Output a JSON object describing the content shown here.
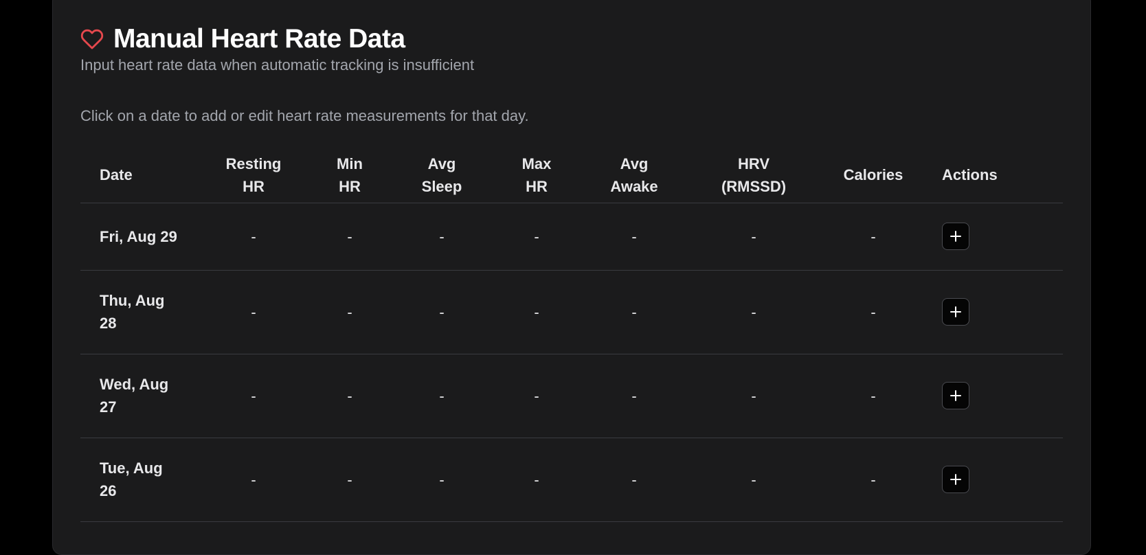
{
  "card": {
    "title": "Manual Heart Rate Data",
    "subtitle": "Input heart rate data when automatic tracking is insufficient",
    "instructions": "Click on a date to add or edit heart rate measurements for that day.",
    "icon": "heart-icon",
    "accent_color": "#e5484d"
  },
  "table": {
    "headers": {
      "date": "Date",
      "resting_hr": [
        "Resting",
        "HR"
      ],
      "min_hr": [
        "Min",
        "HR"
      ],
      "avg_sleep": [
        "Avg",
        "Sleep"
      ],
      "max_hr": [
        "Max",
        "HR"
      ],
      "avg_awake": [
        "Avg",
        "Awake"
      ],
      "hrv": [
        "HRV",
        "(RMSSD)"
      ],
      "calories": "Calories",
      "actions": "Actions"
    },
    "rows": [
      {
        "date": "Fri, Aug 29",
        "resting_hr": "-",
        "min_hr": "-",
        "avg_sleep": "-",
        "max_hr": "-",
        "avg_awake": "-",
        "hrv": "-",
        "calories": "-",
        "action_icon": "plus-icon"
      },
      {
        "date": [
          "Thu, Aug",
          "28"
        ],
        "resting_hr": "-",
        "min_hr": "-",
        "avg_sleep": "-",
        "max_hr": "-",
        "avg_awake": "-",
        "hrv": "-",
        "calories": "-",
        "action_icon": "plus-icon"
      },
      {
        "date": [
          "Wed, Aug",
          "27"
        ],
        "resting_hr": "-",
        "min_hr": "-",
        "avg_sleep": "-",
        "max_hr": "-",
        "avg_awake": "-",
        "hrv": "-",
        "calories": "-",
        "action_icon": "plus-icon"
      },
      {
        "date": [
          "Tue, Aug",
          "26"
        ],
        "resting_hr": "-",
        "min_hr": "-",
        "avg_sleep": "-",
        "max_hr": "-",
        "avg_awake": "-",
        "hrv": "-",
        "calories": "-",
        "action_icon": "plus-icon"
      }
    ]
  }
}
